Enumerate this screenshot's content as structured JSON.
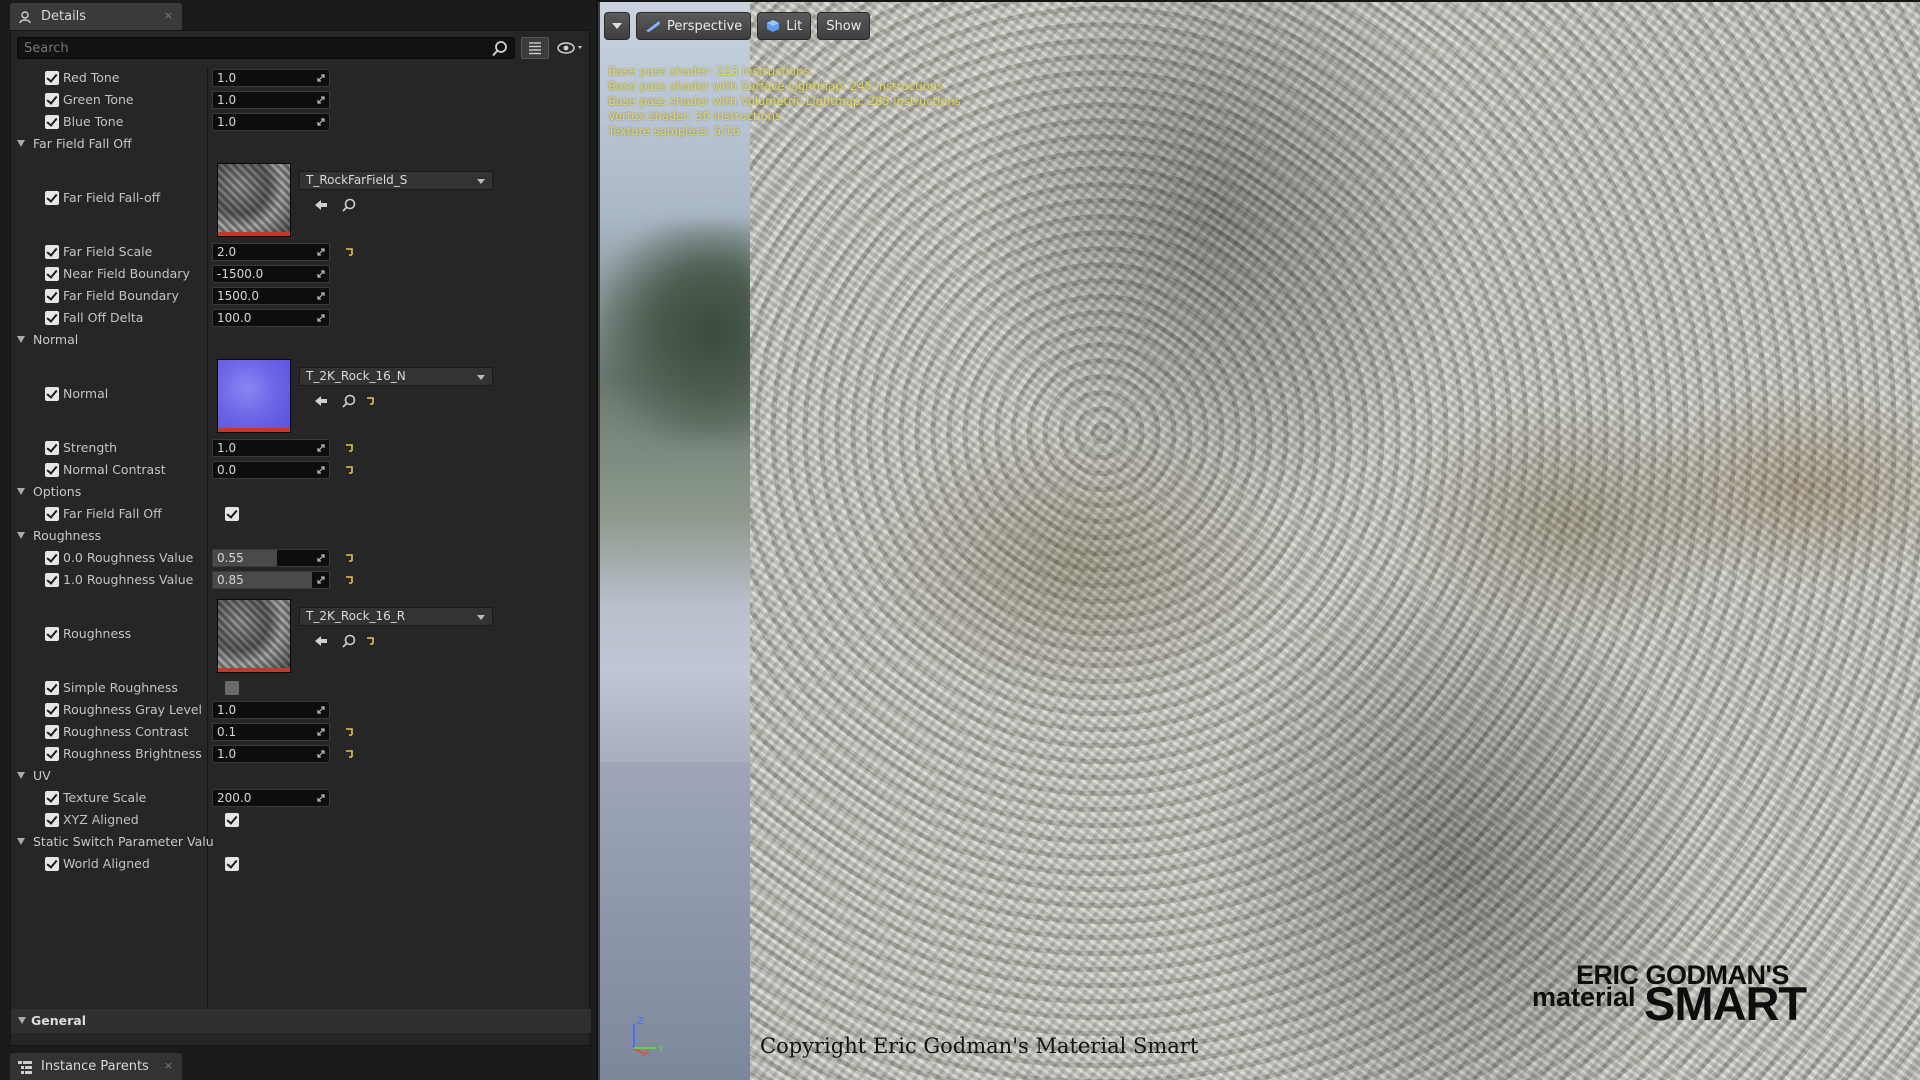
{
  "details_tab": {
    "title": "Details",
    "close": "×",
    "icon": "details-icon"
  },
  "instance_parents_tab": {
    "title": "Instance Parents",
    "close": "×",
    "icon": "hierarchy-icon"
  },
  "search": {
    "placeholder": "Search",
    "value": ""
  },
  "categories": {
    "far_field_fall_off": "Far Field Fall Off",
    "normal": "Normal",
    "options": "Options",
    "roughness": "Roughness",
    "uv": "UV",
    "static_switch": "Static Switch Parameter Valu",
    "general": "General"
  },
  "props": {
    "red_tone": {
      "label": "Red Tone",
      "value": "1.0"
    },
    "green_tone": {
      "label": "Green Tone",
      "value": "1.0"
    },
    "blue_tone": {
      "label": "Blue Tone",
      "value": "1.0"
    },
    "far_field_falloff_tex": {
      "label": "Far Field Fall-off",
      "asset": "T_RockFarField_S"
    },
    "far_field_scale": {
      "label": "Far Field Scale",
      "value": "2.0"
    },
    "near_field_boundary": {
      "label": "Near Field Boundary",
      "value": "-1500.0"
    },
    "far_field_boundary": {
      "label": "Far Field Boundary",
      "value": "1500.0"
    },
    "fall_off_delta": {
      "label": "Fall Off Delta",
      "value": "100.0"
    },
    "normal_tex": {
      "label": "Normal",
      "asset": "T_2K_Rock_16_N"
    },
    "strength": {
      "label": "Strength",
      "value": "1.0"
    },
    "normal_contrast": {
      "label": "Normal Contrast",
      "value": "0.0"
    },
    "far_field_fall_off_bool": {
      "label": "Far Field Fall Off",
      "checked": true
    },
    "roughness_0": {
      "label": "0.0 Roughness Value",
      "value": "0.55",
      "fill": 0.55
    },
    "roughness_1": {
      "label": "1.0 Roughness Value",
      "value": "0.85",
      "fill": 0.85
    },
    "roughness_tex": {
      "label": "Roughness",
      "asset": "T_2K_Rock_16_R"
    },
    "simple_roughness": {
      "label": "Simple Roughness",
      "checked": false
    },
    "roughness_gray_level": {
      "label": "Roughness Gray Level",
      "value": "1.0"
    },
    "roughness_contrast": {
      "label": "Roughness Contrast",
      "value": "0.1"
    },
    "roughness_brightness": {
      "label": "Roughness Brightness",
      "value": "1.0"
    },
    "texture_scale": {
      "label": "Texture Scale",
      "value": "200.0"
    },
    "xyz_aligned": {
      "label": "XYZ Aligned",
      "checked": true
    },
    "world_aligned": {
      "label": "World Aligned",
      "checked": true
    }
  },
  "viewport": {
    "perspective_label": "Perspective",
    "lit_label": "Lit",
    "show_label": "Show",
    "stats": [
      "Base pass shader: 223 instructions",
      "Base pass shader with Surface Lightmap: 245 instructions",
      "Base pass shader with Volumetric Lightmap: 285 instructions",
      "Vertex shader: 30 instructions",
      "Texture samplers: 5/16"
    ],
    "axis": {
      "z": "Z",
      "x": "X",
      "y": "Y"
    },
    "copyright": "Copyright Eric Godman's Material Smart",
    "logo": {
      "line1": "ERIC GODMAN'S",
      "line2a": "material",
      "line2b": "SMART"
    }
  },
  "colors": {
    "accent_red": "#c0392b",
    "stats_yellow": "#e6d84a",
    "normal_blue": "#6b64e6"
  }
}
